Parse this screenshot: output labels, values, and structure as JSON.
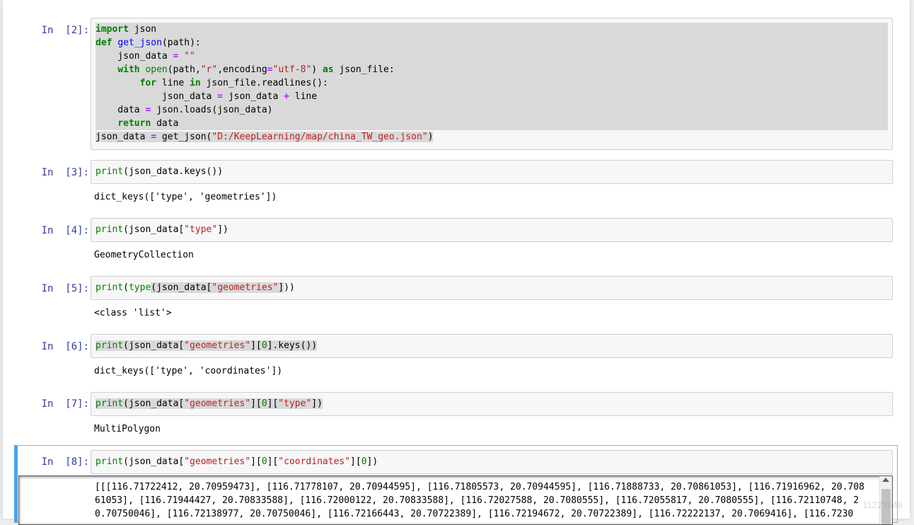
{
  "cells": [
    {
      "prompt": "In  [2]:"
    },
    {
      "prompt": "In  [3]:",
      "output": "dict_keys(['type', 'geometries'])"
    },
    {
      "prompt": "In  [4]:",
      "output": "GeometryCollection"
    },
    {
      "prompt": "In  [5]:",
      "output": "<class 'list'>"
    },
    {
      "prompt": "In  [6]:",
      "output": "dict_keys(['type', 'coordinates'])"
    },
    {
      "prompt": "In  [7]:",
      "output": "MultiPolygon"
    },
    {
      "prompt": "In  [8]:",
      "output": "[[[116.71722412, 20.70959473], [116.71778107, 20.70944595], [116.71805573, 20.70944595], [116.71888733, 20.70861053], [116.71916962, 20.70861053], [116.71944427, 20.70833588], [116.72000122, 20.70833588], [116.72027588, 20.7080555], [116.72055817, 20.7080555], [116.72110748, 20.70750046], [116.72138977, 20.70750046], [116.72166443, 20.70722389], [116.72194672, 20.70722389], [116.72222137, 20.7069416], [116.7230"
    }
  ],
  "watermark": "11227646"
}
